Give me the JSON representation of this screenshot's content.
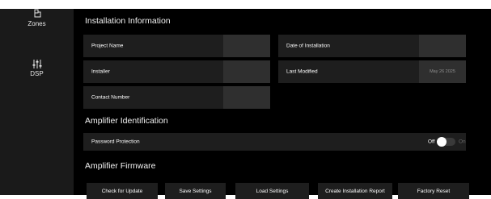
{
  "sidebar": {
    "items": [
      {
        "label": "Zones",
        "icon": "zones-icon"
      },
      {
        "label": "DSP",
        "icon": "sliders-icon"
      }
    ]
  },
  "installation": {
    "title": "Installation Information",
    "project_name": {
      "label": "Project Name",
      "value": ""
    },
    "date_of_installation": {
      "label": "Date of Installation",
      "value": ""
    },
    "installer": {
      "label": "Installer",
      "value": ""
    },
    "last_modified": {
      "label": "Last Modified",
      "value": "May 26 2025"
    },
    "contact_number": {
      "label": "Contact Number",
      "value": ""
    }
  },
  "identification": {
    "title": "Amplifier Identification",
    "password_protection": {
      "label": "Password Protection",
      "off_label": "Off",
      "on_label": "On",
      "enabled": false
    }
  },
  "firmware": {
    "title": "Amplifier Firmware",
    "buttons": [
      "Check for Update",
      "Save Settings",
      "Load Settings",
      "Create Installation Report",
      "Factory Reset"
    ]
  },
  "colors": {
    "background": "#000000",
    "panel": "#1e1e1e",
    "input": "#2f2f2f",
    "sidebar": "#1a1a1a"
  }
}
